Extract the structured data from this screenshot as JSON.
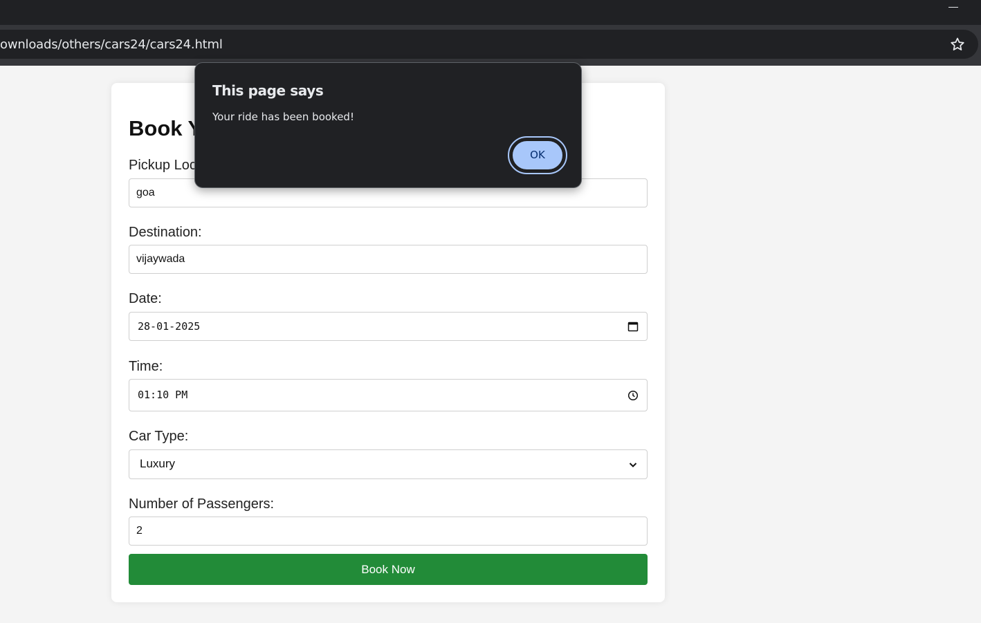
{
  "browser": {
    "url": "ownloads/others/cars24/cars24.html"
  },
  "form": {
    "heading": "Book Your Ride",
    "pickup_label": "Pickup Location:",
    "pickup_value": "goa",
    "destination_label": "Destination:",
    "destination_value": "vijaywada",
    "date_label": "Date:",
    "date_value": "28-01-2025",
    "time_label": "Time:",
    "time_value": "01:10 PM",
    "car_type_label": "Car Type:",
    "car_type_value": "Luxury",
    "passengers_label": "Number of Passengers:",
    "passengers_value": "2",
    "submit_label": "Book Now"
  },
  "dialog": {
    "title": "This page says",
    "message": "Your ride has been booked!",
    "ok_label": "OK"
  },
  "colors": {
    "accent_green": "#228b38",
    "dialog_bg": "#202124",
    "ok_button": "#a8c7fa"
  }
}
